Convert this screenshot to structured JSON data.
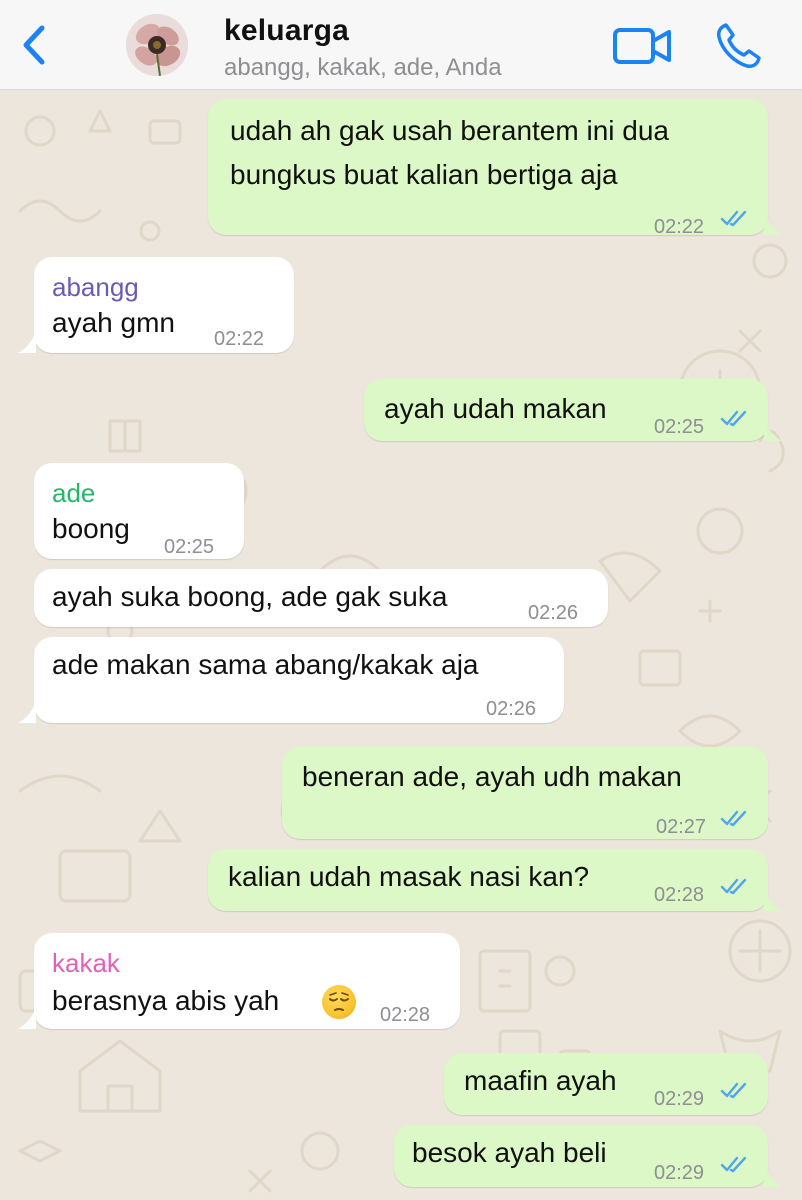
{
  "header": {
    "title": "keluarga",
    "subtitle": "abangg, kakak, ade, Anda"
  },
  "colors": {
    "ios_blue": "#1a83f5",
    "outgoing_bubble": "#dcf8c6",
    "incoming_bubble": "#ffffff",
    "sender_abangg": "#6b5bb8",
    "sender_ade": "#25b86a",
    "sender_kakak": "#e360b9",
    "read_ticks": "#4fa6ef"
  },
  "messages": [
    {
      "direction": "out",
      "lines": [
        "udah ah gak usah berantem ini dua",
        "bungkus buat kalian bertiga aja"
      ],
      "time": "02:22",
      "status": "read"
    },
    {
      "direction": "in",
      "sender": "abangg",
      "text": "ayah gmn",
      "time": "02:22"
    },
    {
      "direction": "out",
      "text": "ayah udah makan",
      "time": "02:25",
      "status": "read"
    },
    {
      "direction": "in",
      "sender": "ade",
      "text": "boong",
      "time": "02:25"
    },
    {
      "direction": "in",
      "text": "ayah suka boong, ade gak suka",
      "time": "02:26"
    },
    {
      "direction": "in",
      "text": "ade makan sama abang/kakak aja",
      "time": "02:26"
    },
    {
      "direction": "out",
      "text": "beneran ade, ayah udh makan",
      "time": "02:27",
      "status": "read"
    },
    {
      "direction": "out",
      "text": "kalian udah masak nasi kan?",
      "time": "02:28",
      "status": "read"
    },
    {
      "direction": "in",
      "sender": "kakak",
      "text": "berasnya abis yah",
      "emoji": "pensive-face",
      "time": "02:28"
    },
    {
      "direction": "out",
      "text": "maafin ayah",
      "time": "02:29",
      "status": "read"
    },
    {
      "direction": "out",
      "text": "besok ayah beli",
      "time": "02:29",
      "status": "read"
    }
  ]
}
